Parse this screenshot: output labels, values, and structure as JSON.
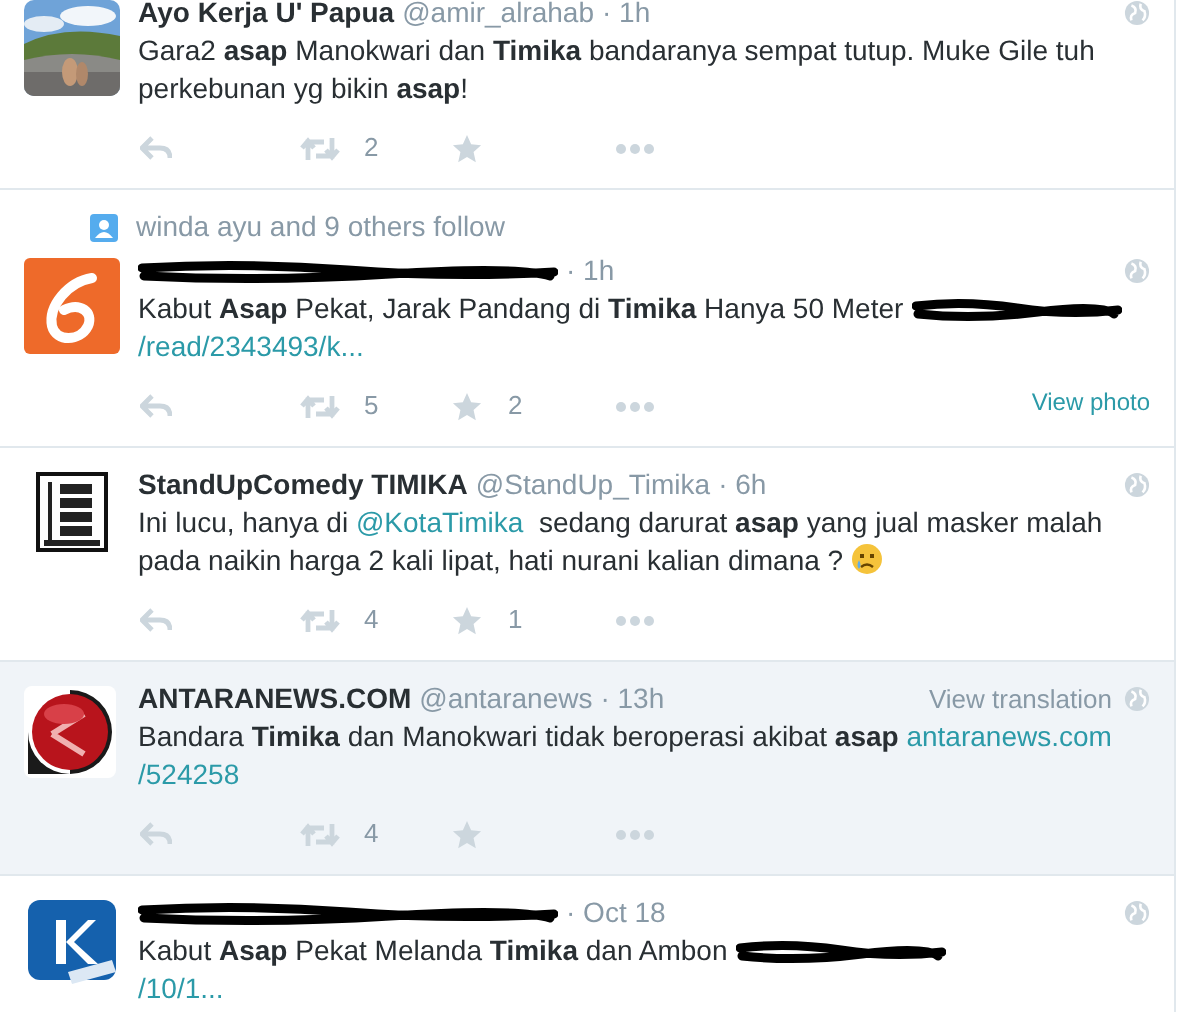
{
  "tweets": [
    {
      "highlighted": false,
      "author": {
        "redacted": false,
        "name": "Ayo Kerja U' Papua",
        "handle": "@amir_alrahab"
      },
      "time": "· 1h",
      "body": [
        {
          "kind": "text",
          "text": "Gara2 **asap** Manokwari dan **Timika** bandaranya sempat tutup. Muke Gile tuh perkebunan yg bikin **asap**!"
        }
      ],
      "actions": {
        "retweets": "2"
      }
    },
    {
      "highlighted": false,
      "social_context": "winda ayu and 9 others follow",
      "avatar": {
        "kind": "swoosh-logo"
      },
      "author": {
        "redacted": true
      },
      "time": "· 1h",
      "body": [
        {
          "kind": "text",
          "text": "Kabut **Asap** Pekat, Jarak Pandang di **Timika** Hanya 50 Meter "
        },
        {
          "kind": "redacted"
        },
        {
          "kind": "link",
          "text": "/read/2343493/k..."
        }
      ],
      "actions": {
        "retweets": "5",
        "favorites": "2"
      },
      "view_photo": "View photo"
    },
    {
      "highlighted": false,
      "avatar": {
        "kind": "poster-logo"
      },
      "author": {
        "redacted": false,
        "name": "StandUpComedy TIMIKA",
        "handle": "@StandUp_Timika"
      },
      "time": "· 6h",
      "body": [
        {
          "kind": "text",
          "text": "Ini lucu, hanya di "
        },
        {
          "kind": "link",
          "text": "@KotaTimika"
        },
        {
          "kind": "text",
          "text": "  sedang darurat **asap** yang jual masker malah pada naikin harga 2 kali lipat, hati nurani kalian dimana ? "
        },
        {
          "kind": "emoji"
        }
      ],
      "actions": {
        "retweets": "4",
        "favorites": "1"
      }
    },
    {
      "highlighted": true,
      "avatar": {
        "kind": "ring-logo"
      },
      "author": {
        "redacted": false,
        "name": "ANTARANEWS.COM",
        "handle": "@antaranews"
      },
      "time": "· 13h",
      "view_translation": "View translation",
      "body": [
        {
          "kind": "text",
          "text": "Bandara **Timika** dan Manokwari tidak beroperasi akibat **asap** "
        },
        {
          "kind": "link",
          "text": "antaranews.com"
        },
        {
          "kind": "link",
          "text": "/524258"
        }
      ],
      "actions": {
        "retweets": "4"
      }
    },
    {
      "highlighted": false,
      "avatar": {
        "kind": "square-logo"
      },
      "author": {
        "redacted": true
      },
      "time": "· Oct 18",
      "body": [
        {
          "kind": "text",
          "text": "Kabut **Asap** Pekat Melanda **Timika** dan Ambon "
        },
        {
          "kind": "redacted"
        },
        {
          "kind": "link",
          "text": "/10/1...",
          "new_line": true
        }
      ]
    }
  ]
}
